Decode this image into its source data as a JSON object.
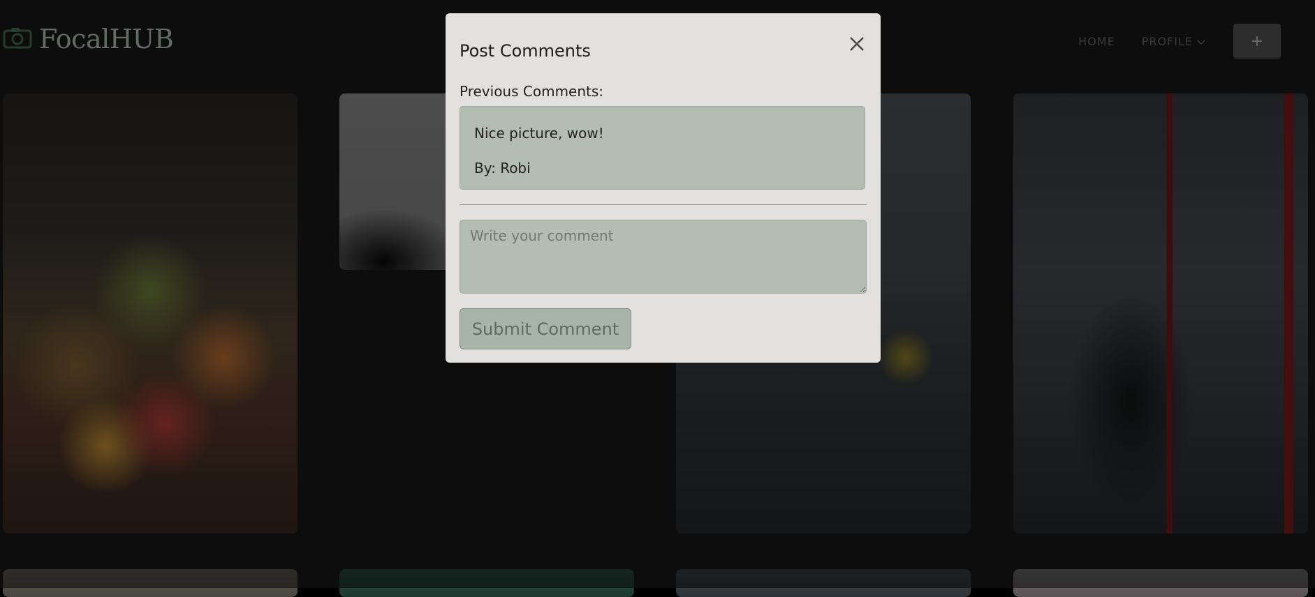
{
  "navbar": {
    "brand": "FocalHUB",
    "brand_icon": "camera-icon",
    "links": {
      "home": "HOME",
      "profile": "PROFILE"
    },
    "add_button": "+"
  },
  "gallery": {
    "photos": [
      "flowers-market",
      "statue",
      "cyclist-street",
      "bookshelf-reader"
    ]
  },
  "modal": {
    "title": "Post Comments",
    "close_icon": "close-icon",
    "previous_label": "Previous Comments:",
    "comments": [
      {
        "text": "Nice picture, wow!",
        "author": "By: Robi"
      }
    ],
    "input_placeholder": "Write your comment",
    "input_value": "",
    "submit_label": "Submit Comment"
  },
  "colors": {
    "modal_bg": "#e2e1df",
    "field_bg": "#b3bdb3",
    "button_bg": "#a8b3a9",
    "brand_accent": "#6b9d7a"
  }
}
